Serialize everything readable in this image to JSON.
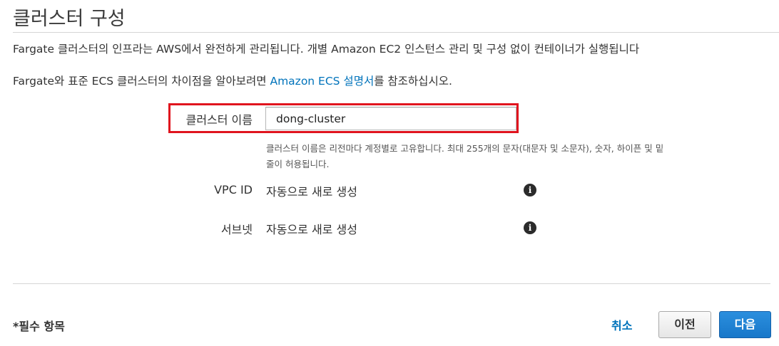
{
  "section": {
    "title": "클러스터 구성"
  },
  "description": {
    "line1": "Fargate 클러스터의 인프라는 AWS에서 완전하게 관리됩니다. 개별 Amazon EC2 인스턴스 관리 및 구성 없이 컨테이너가 실행됩니다",
    "line2_prefix": "Fargate와 표준 ECS 클러스터의 차이점을 알아보려면 ",
    "line2_link": "Amazon ECS 설명서",
    "line2_suffix": "를 참조하십시오."
  },
  "cluster_name": {
    "label": "클러스터 이름",
    "value": "dong-cluster",
    "hint_line1": "클러스터 이름은 리전마다 계정별로 고유합니다. 최대 255개의 문자(대문자 및 소문자), 숫자, 하이픈 및 밑",
    "hint_line2": "줄이 허용됩니다."
  },
  "vpc": {
    "label": "VPC ID",
    "value": "자동으로 새로 생성",
    "info_icon": "info-icon"
  },
  "subnet": {
    "label": "서브넷",
    "value": "자동으로 새로 생성",
    "info_icon": "info-icon"
  },
  "footer": {
    "required_note": "*필수 항목",
    "cancel_label": "취소",
    "prev_label": "이전",
    "next_label": "다음"
  },
  "colors": {
    "link": "#0073bb",
    "highlight": "#e0141e",
    "primary_button": "#1877c9"
  }
}
